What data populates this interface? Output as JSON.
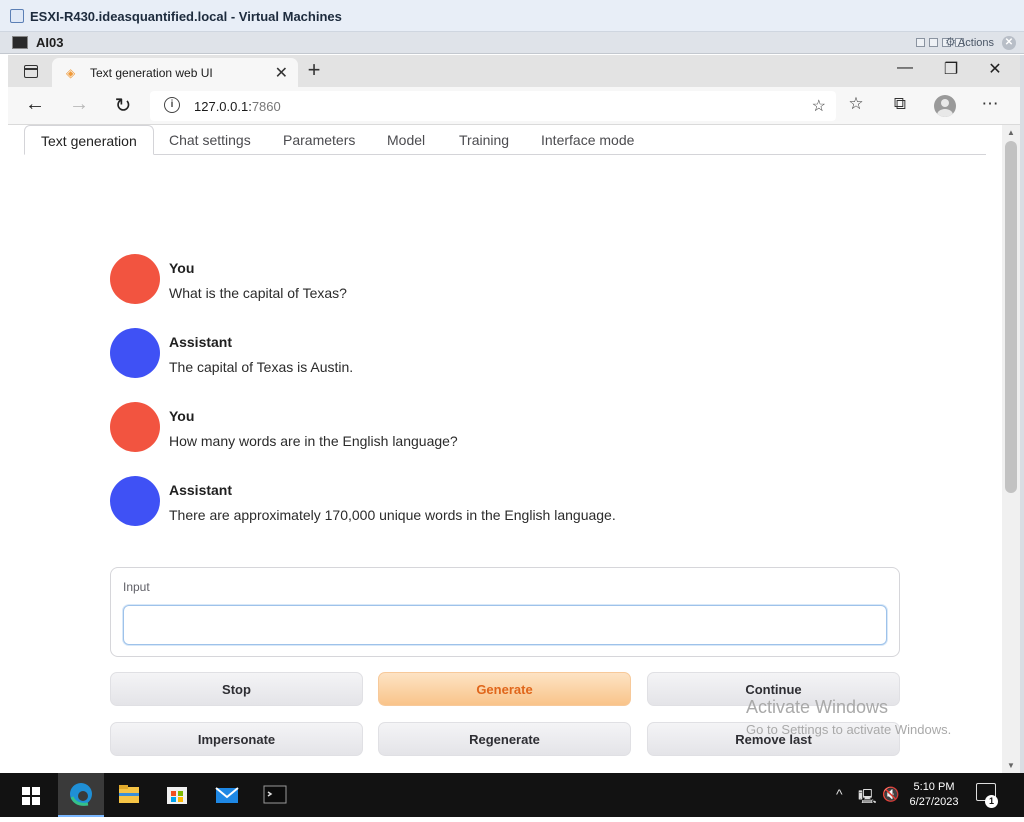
{
  "vm_console": {
    "window_title": "ESXI-R430.ideasquantified.local - Virtual Machines",
    "vm_name": "AI03",
    "actions_label": "Actions"
  },
  "browser": {
    "tab_title": "Text generation web UI",
    "url_host": "127.0.0.1:",
    "url_port": "7860"
  },
  "app": {
    "tabs": [
      {
        "label": "Text generation",
        "active": true
      },
      {
        "label": "Chat settings",
        "active": false
      },
      {
        "label": "Parameters",
        "active": false
      },
      {
        "label": "Model",
        "active": false
      },
      {
        "label": "Training",
        "active": false
      },
      {
        "label": "Interface mode",
        "active": false
      }
    ],
    "messages": [
      {
        "sender": "You",
        "text": "What is the capital of Texas?",
        "avatar_color": "#f25440"
      },
      {
        "sender": "Assistant",
        "text": "The capital of Texas is Austin.",
        "avatar_color": "#3f51f5"
      },
      {
        "sender": "You",
        "text": "How many words are in the English language?",
        "avatar_color": "#f25440"
      },
      {
        "sender": "Assistant",
        "text": "There are approximately 170,000 unique words in the English language.",
        "avatar_color": "#3f51f5"
      }
    ],
    "input": {
      "label": "Input",
      "value": "",
      "placeholder": ""
    },
    "buttons": {
      "stop": "Stop",
      "generate": "Generate",
      "continue": "Continue",
      "impersonate": "Impersonate",
      "regenerate": "Regenerate",
      "remove_last": "Remove last"
    }
  },
  "watermark": {
    "line1": "Activate Windows",
    "line2": "Go to Settings to activate Windows."
  },
  "taskbar": {
    "time": "5:10 PM",
    "date": "6/27/2023",
    "notification_count": "1"
  },
  "colors": {
    "user_avatar": "#f25440",
    "assistant_avatar": "#3f51f5",
    "primary_button_text": "#e0661b"
  }
}
